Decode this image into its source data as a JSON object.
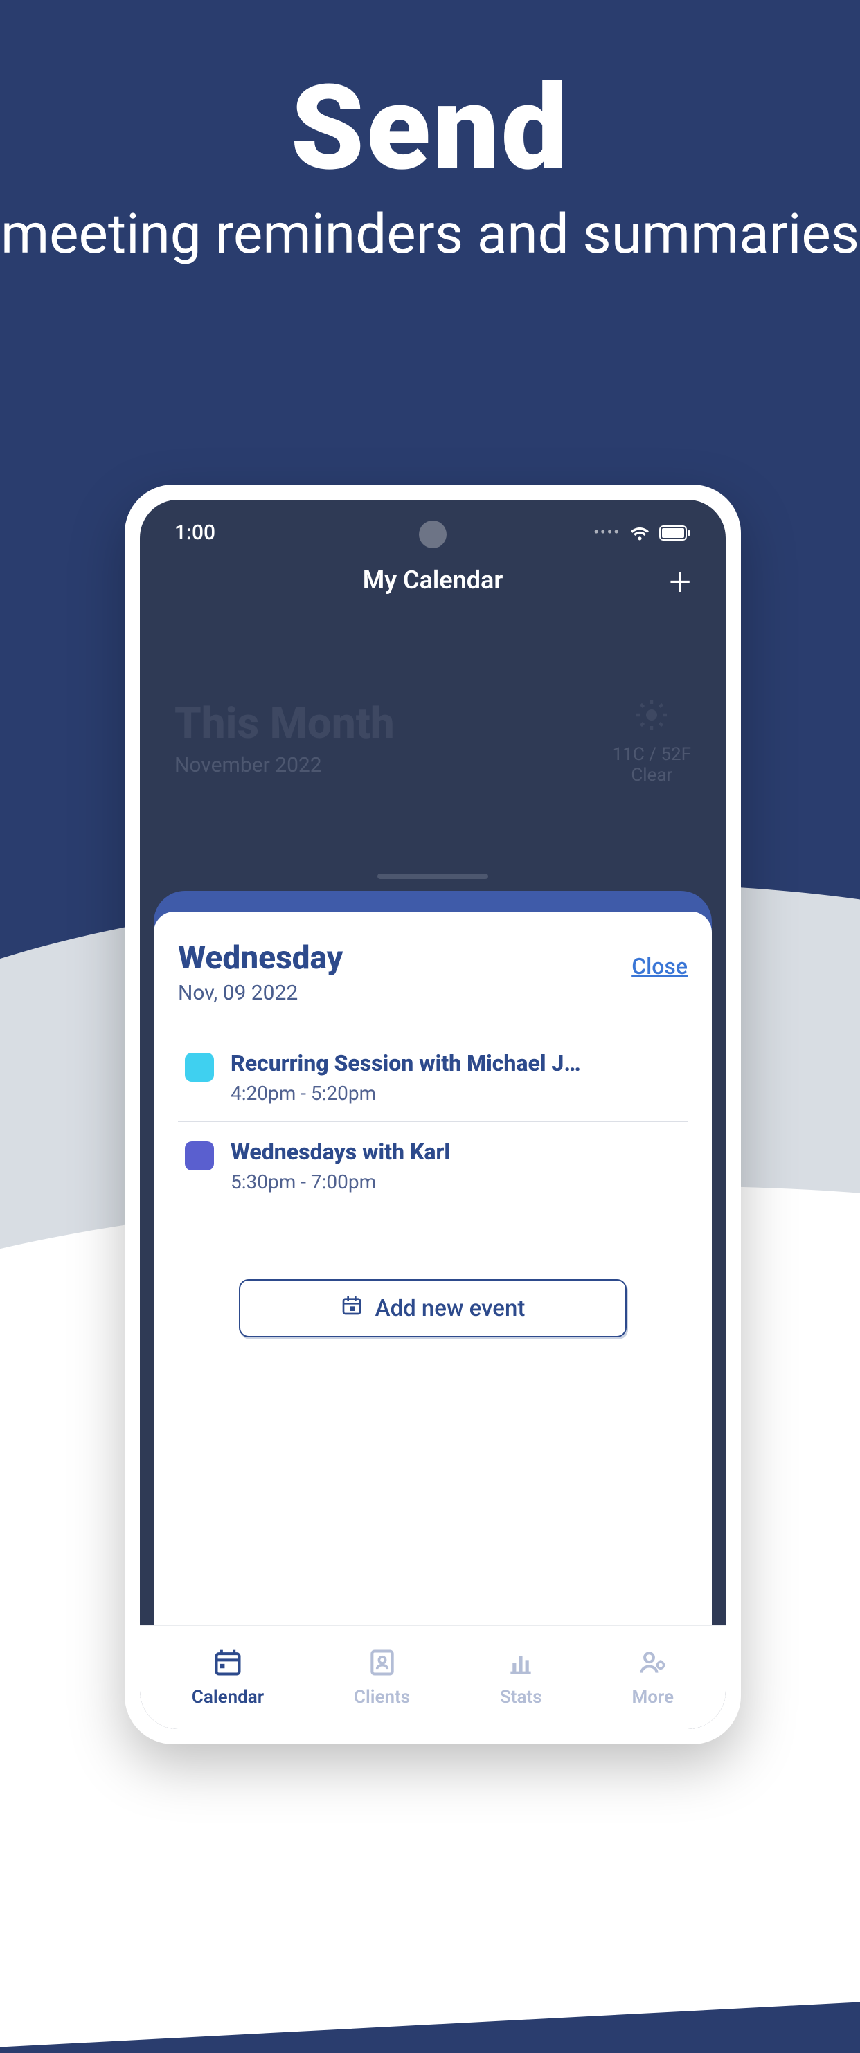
{
  "promo": {
    "headline": "Send",
    "subline": "meeting reminders and summaries"
  },
  "status": {
    "time": "1:00"
  },
  "header": {
    "title": "My Calendar"
  },
  "month": {
    "title": "This Month",
    "subtitle": "November 2022"
  },
  "weather": {
    "temp": "11C / 52F",
    "desc": "Clear"
  },
  "sheet": {
    "day": "Wednesday",
    "date": "Nov, 09 2022",
    "close": "Close",
    "add_label": "Add new event",
    "events": [
      {
        "title": "Recurring Session with Michael J…",
        "time": "4:20pm - 5:20pm",
        "color": "#3fd0f0"
      },
      {
        "title": "Wednesdays with Karl",
        "time": "5:30pm - 7:00pm",
        "color": "#5a5fcf"
      }
    ]
  },
  "tabs": {
    "calendar": "Calendar",
    "clients": "Clients",
    "stats": "Stats",
    "more": "More"
  }
}
